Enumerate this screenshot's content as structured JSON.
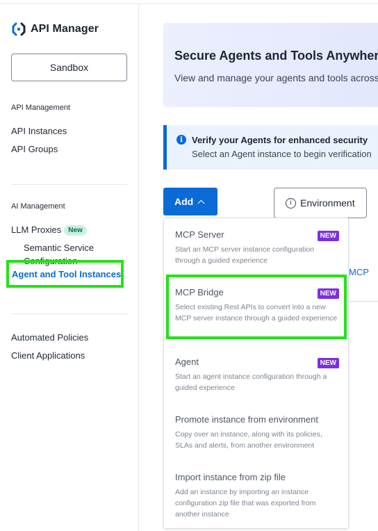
{
  "app": {
    "title": "API Manager"
  },
  "sidebar": {
    "sandbox_label": "Sandbox",
    "sections": [
      {
        "title": "API Management",
        "items": [
          "API Instances",
          "API Groups"
        ]
      },
      {
        "title": "AI Management",
        "items": [
          "LLM Proxies"
        ],
        "llm_badge": "New",
        "sub_items": [
          "Semantic Service Configuration"
        ],
        "active_item": "Agent and Tool Instances"
      }
    ],
    "bottom_items": [
      "Automated Policies",
      "Client Applications"
    ]
  },
  "main": {
    "hero_title": "Secure Agents and Tools Anywhere",
    "hero_subtitle": "View and manage your agents and tools across",
    "notice_title": "Verify your Agents for enhanced security",
    "notice_text": "Select an Agent instance to begin verification",
    "add_label": "Add",
    "environment_label": "Environment",
    "background_tab_text": "MCP"
  },
  "dropdown": {
    "items": [
      {
        "title": "MCP Server",
        "badge": "NEW",
        "desc": "Start an MCP server instance configuration through a guided experience"
      },
      {
        "title": "MCP Bridge",
        "badge": "NEW",
        "desc": "Select existing Rest APIs to convert into a new MCP server instance through a guided experience"
      },
      {
        "title": "Agent",
        "badge": "NEW",
        "desc": "Start an agent instance configuration through a guided experience"
      },
      {
        "title": "Promote instance from environment",
        "badge": "",
        "desc": "Copy over an instance, along with its policies, SLAs and alerts, from another environment"
      },
      {
        "title": "Import instance from zip file",
        "badge": "",
        "desc": "Add an instance by importing an instance configuration zip file that was exported from another instance"
      }
    ]
  },
  "colors": {
    "accent": "#0a6ad6",
    "highlight": "#22e315",
    "badge_purple": "#7b2fe0",
    "badge_green_bg": "#c9f0e4"
  }
}
